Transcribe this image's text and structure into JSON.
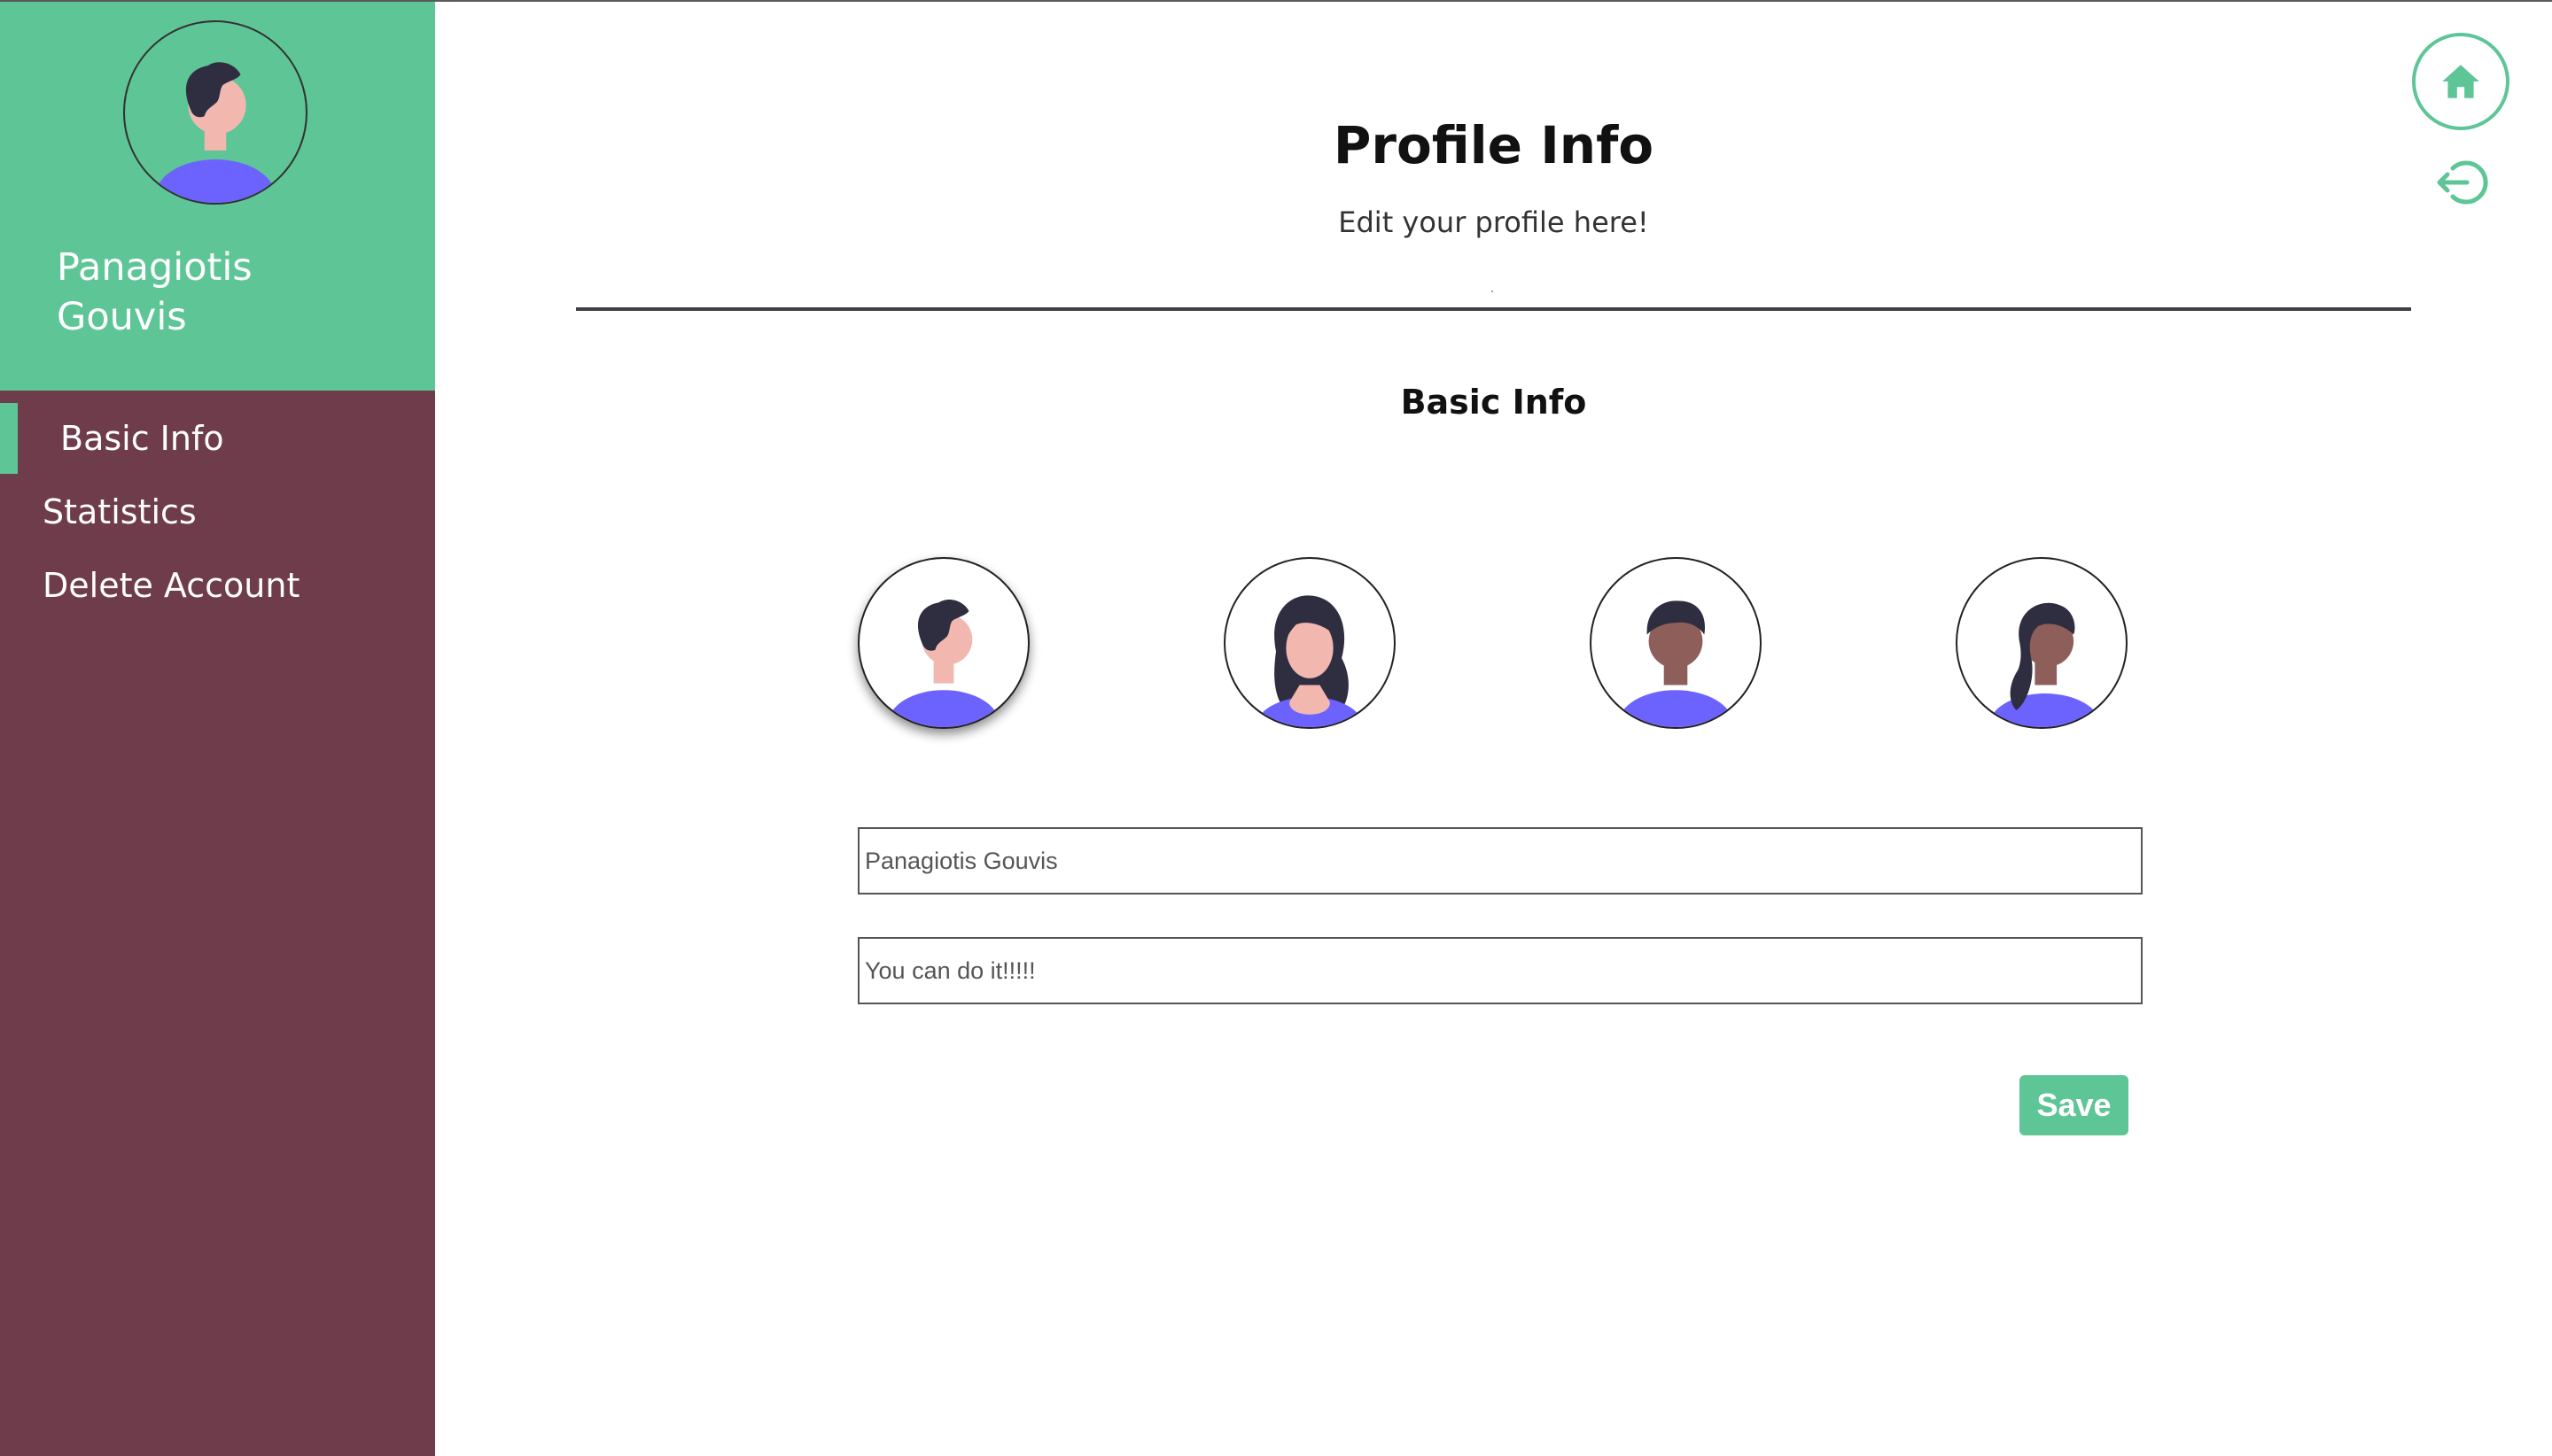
{
  "user": {
    "name": "Panagiotis\nGouvis"
  },
  "nav": {
    "items": [
      {
        "label": "Basic Info",
        "active": true
      },
      {
        "label": "Statistics",
        "active": false
      },
      {
        "label": "Delete Account",
        "active": false
      }
    ]
  },
  "header": {
    "title": "Profile Info",
    "subtitle": "Edit your profile here!"
  },
  "section": {
    "title": "Basic Info"
  },
  "avatars": {
    "options": [
      "man-short-hair-avatar",
      "woman-long-hair-avatar",
      "man-dark-skin-avatar",
      "woman-ponytail-avatar"
    ],
    "selected_index": 0
  },
  "form": {
    "name_value": "Panagiotis Gouvis",
    "motto_value": "You can do it!!!!!",
    "save_label": "Save"
  },
  "icons": {
    "home": "home-icon",
    "logout": "logout-icon"
  },
  "colors": {
    "accent": "#5ec597",
    "sidebar": "#6e3c4a",
    "avatar_shirt": "#6c63ff"
  }
}
